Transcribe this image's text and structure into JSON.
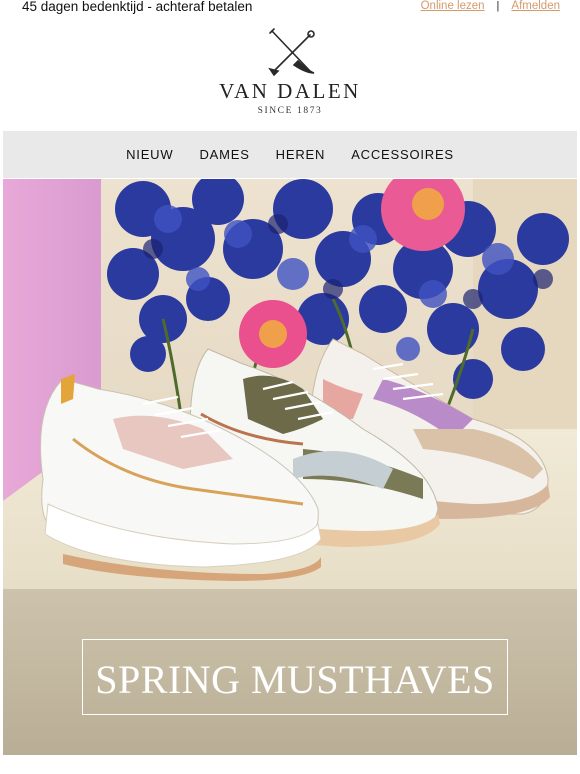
{
  "topbar": {
    "tagline": "45 dagen bedenktijd - achteraf betalen",
    "online_link": "Online lezen",
    "separator": "|",
    "unsubscribe_link": "Afmelden"
  },
  "logo": {
    "brand": "VAN DALEN",
    "since": "SINCE 1873",
    "icon": "crossed-tools-icon"
  },
  "nav": {
    "items": [
      "NIEUW",
      "DAMES",
      "HEREN",
      "ACCESSOIRES"
    ]
  },
  "hero": {
    "title": "SPRING MUSTHAVES"
  },
  "colors": {
    "link": "#d39a6a",
    "nav_bg": "#e9e9e9",
    "hero_wall": "#e5dccb",
    "hero_floor": "#c9bfa8",
    "flower_blue": "#2b3a9e",
    "flower_pink": "#ea4f8e"
  }
}
